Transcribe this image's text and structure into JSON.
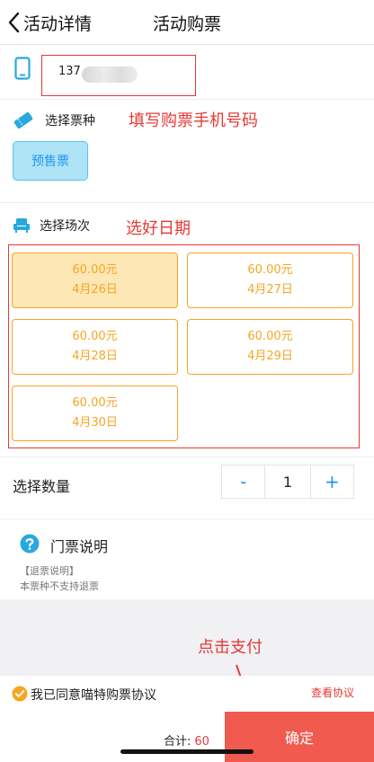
{
  "nav": {
    "back_label": "活动详情",
    "title": "活动购票"
  },
  "phone": {
    "value": "137"
  },
  "ticket_type": {
    "label": "选择票种",
    "options": [
      "预售票"
    ]
  },
  "session": {
    "label": "选择场次",
    "options": [
      {
        "price": "60.00元",
        "date": "4月26日"
      },
      {
        "price": "60.00元",
        "date": "4月27日"
      },
      {
        "price": "60.00元",
        "date": "4月28日"
      },
      {
        "price": "60.00元",
        "date": "4月29日"
      },
      {
        "price": "60.00元",
        "date": "4月30日"
      }
    ]
  },
  "quantity": {
    "label": "选择数量",
    "minus": "-",
    "value": "1",
    "plus": "+"
  },
  "notice": {
    "title": "门票说明",
    "subtitle": "【退票说明】",
    "text": "本票种不支持退票"
  },
  "agreement": {
    "text": "我已同意喵特购票协议",
    "link": "查看协议"
  },
  "footer": {
    "total_label": "合计:",
    "total_value": "60",
    "confirm_label": "确定"
  },
  "annotations": {
    "phone_hint": "填写购票手机号码",
    "date_hint": "选好日期",
    "pay_hint": "点击支付"
  },
  "colors": {
    "accent": "#2196f3",
    "orange": "#f5a623",
    "annotation_red": "#e53935",
    "confirm": "#f05a4f"
  }
}
